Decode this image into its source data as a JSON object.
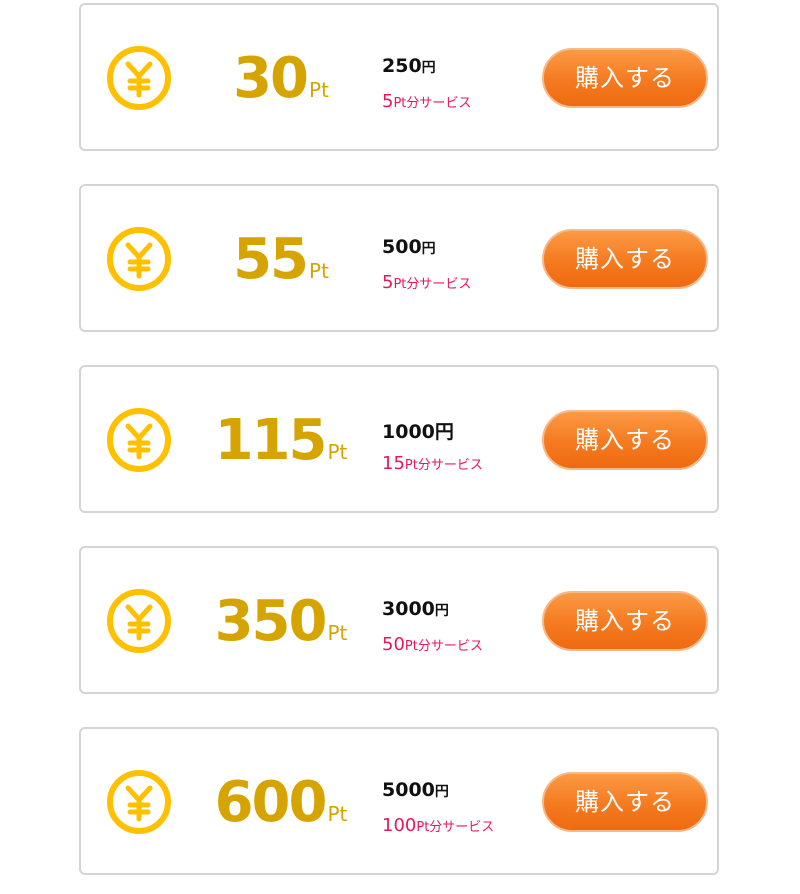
{
  "colors": {
    "coin": "#ffc000",
    "points_text": "#d6a400",
    "bonus_text": "#e8175d",
    "button_bg": "#f57a20",
    "card_border": "#d4d4d4"
  },
  "icons": {
    "coin": "yen-coin-icon"
  },
  "plans": [
    {
      "points": "30",
      "points_unit": "Pt",
      "price": "250",
      "price_unit": "円",
      "bonus_number": "5",
      "bonus_text": "Pt分サービス",
      "button_label": "購入する"
    },
    {
      "points": "55",
      "points_unit": "Pt",
      "price": "500",
      "price_unit": "円",
      "bonus_number": "5",
      "bonus_text": "Pt分サービス",
      "button_label": "購入する"
    },
    {
      "points": "115",
      "points_unit": "Pt",
      "price": "1000",
      "price_unit": "円",
      "bonus_number": "15",
      "bonus_text": "Pt分サービス",
      "button_label": "購入する"
    },
    {
      "points": "350",
      "points_unit": "Pt",
      "price": "3000",
      "price_unit": "円",
      "bonus_number": "50",
      "bonus_text": "Pt分サービス",
      "button_label": "購入する"
    },
    {
      "points": "600",
      "points_unit": "Pt",
      "price": "5000",
      "price_unit": "円",
      "bonus_number": "100",
      "bonus_text": "Pt分サービス",
      "button_label": "購入する"
    }
  ]
}
